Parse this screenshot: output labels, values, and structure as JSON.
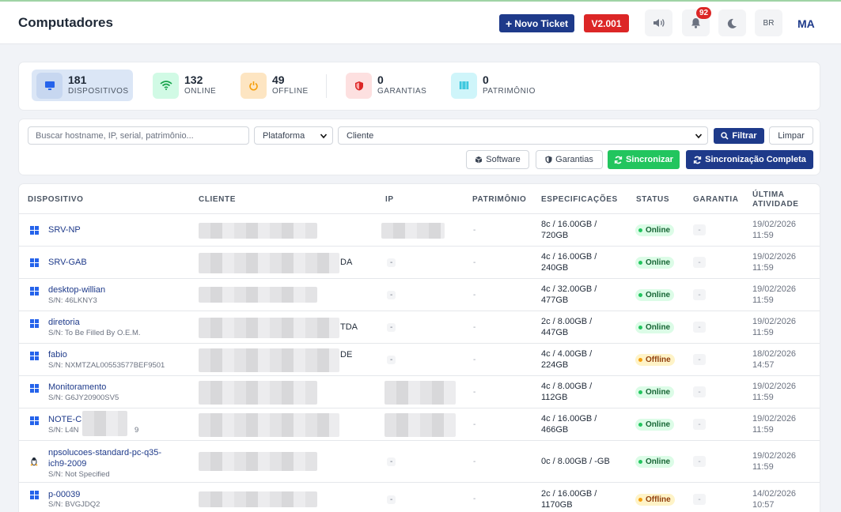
{
  "header": {
    "title": "Computadores",
    "new_ticket": "Novo Ticket",
    "version": "V2.001",
    "notifications_count": "92",
    "lang": "BR",
    "user_initials": "MA"
  },
  "stats": [
    {
      "value": "181",
      "label": "DISPOSITIVOS"
    },
    {
      "value": "132",
      "label": "ONLINE"
    },
    {
      "value": "49",
      "label": "OFFLINE"
    },
    {
      "value": "0",
      "label": "GARANTIAS"
    },
    {
      "value": "0",
      "label": "PATRIMÔNIO"
    }
  ],
  "filters": {
    "search_placeholder": "Buscar hostname, IP, serial, patrimônio...",
    "platform": "Plataforma",
    "client": "Cliente",
    "filter_btn": "Filtrar",
    "clear_btn": "Limpar",
    "software_btn": "Software",
    "warranty_btn": "Garantias",
    "sync_btn": "Sincronizar",
    "sync_full_btn": "Sincronização Completa"
  },
  "table": {
    "columns": {
      "device": "DISPOSITIVO",
      "client": "CLIENTE",
      "ip": "IP",
      "asset": "PATRIMÔNIO",
      "specs": "ESPECIFICAÇÕES",
      "status": "STATUS",
      "warranty": "GARANTIA",
      "activity1": "ÚLTIMA",
      "activity2": "ATIVIDADE"
    },
    "rows": [
      {
        "os": "windows",
        "name": "SRV-NP",
        "sn": "",
        "client_tail": "",
        "ip": "",
        "asset": "-",
        "specs1": "8c / 16.00GB /",
        "specs2": "720GB",
        "status": "Online",
        "warranty": "-",
        "date": "19/02/2026",
        "time": "11:59"
      },
      {
        "os": "windows",
        "name": "SRV-GAB",
        "sn": "",
        "client_tail": "DA",
        "ip": "-",
        "asset": "-",
        "specs1": "4c / 16.00GB /",
        "specs2": "240GB",
        "status": "Online",
        "warranty": "-",
        "date": "19/02/2026",
        "time": "11:59"
      },
      {
        "os": "windows",
        "name": "desktop-willian",
        "sn": "S/N: 46LKNY3",
        "client_tail": "",
        "ip": "-",
        "asset": "-",
        "specs1": "4c / 32.00GB /",
        "specs2": "477GB",
        "status": "Online",
        "warranty": "-",
        "date": "19/02/2026",
        "time": "11:59"
      },
      {
        "os": "windows",
        "name": "diretoria",
        "sn": "S/N: To Be Filled By O.E.M.",
        "client_tail": "TDA",
        "ip": "-",
        "asset": "-",
        "specs1": "2c / 8.00GB /",
        "specs2": "447GB",
        "status": "Online",
        "warranty": "-",
        "date": "19/02/2026",
        "time": "11:59"
      },
      {
        "os": "windows",
        "name": "fabio",
        "sn": "S/N: NXMTZAL00553577BEF9501",
        "client_tail": "DE",
        "ip": "-",
        "asset": "-",
        "specs1": "4c / 4.00GB /",
        "specs2": "224GB",
        "status": "Offline",
        "warranty": "-",
        "date": "18/02/2026",
        "time": "14:57"
      },
      {
        "os": "windows",
        "name": "Monitoramento",
        "sn": "S/N: G6JY20900SV5",
        "client_tail": "",
        "ip": "",
        "asset": "-",
        "specs1": "4c / 8.00GB /",
        "specs2": "112GB",
        "status": "Online",
        "warranty": "-",
        "date": "19/02/2026",
        "time": "11:59"
      },
      {
        "os": "windows",
        "name": "NOTE-C",
        "sn": "S/N: L4N",
        "sn_tail": "9",
        "client_tail": "",
        "ip": "",
        "asset": "-",
        "specs1": "4c / 16.00GB /",
        "specs2": "466GB",
        "status": "Online",
        "warranty": "-",
        "date": "19/02/2026",
        "time": "11:59"
      },
      {
        "os": "linux",
        "name": "npsolucoes-standard-pc-q35-",
        "name2": "ich9-2009",
        "sn": "S/N: Not Specified",
        "client_tail": "",
        "ip": "-",
        "asset": "-",
        "specs1": "0c / 8.00GB / -GB",
        "specs2": "",
        "status": "Online",
        "warranty": "-",
        "date": "19/02/2026",
        "time": "11:59"
      },
      {
        "os": "windows",
        "name": "p-00039",
        "sn": "S/N: BVGJDQ2",
        "client_tail": "",
        "ip": "-",
        "asset": "-",
        "specs1": "2c / 16.00GB /",
        "specs2": "1170GB",
        "status": "Offline",
        "warranty": "-",
        "date": "14/02/2026",
        "time": "10:57"
      }
    ]
  }
}
